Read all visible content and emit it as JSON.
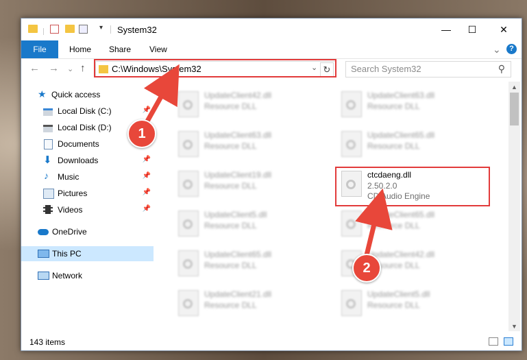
{
  "window": {
    "title": "System32"
  },
  "titlebar": {
    "minimize_glyph": "—",
    "maximize_glyph": "☐",
    "close_glyph": "✕"
  },
  "ribbon": {
    "tabs": [
      {
        "label": "File"
      },
      {
        "label": "Home"
      },
      {
        "label": "Share"
      },
      {
        "label": "View"
      }
    ],
    "expand_glyph": "⌄",
    "help_glyph": "?"
  },
  "nav": {
    "back_glyph": "←",
    "forward_glyph": "→",
    "recent_glyph": "⌄",
    "up_glyph": "↑",
    "address": "C:\\Windows\\System32",
    "address_dropdown_glyph": "⌄",
    "refresh_glyph": "↻",
    "search_placeholder": "Search System32",
    "search_glyph": "⚲"
  },
  "sidebar": {
    "items": [
      {
        "label": "Quick access"
      },
      {
        "label": "Local Disk (C:)"
      },
      {
        "label": "Local Disk (D:)"
      },
      {
        "label": "Documents"
      },
      {
        "label": "Downloads"
      },
      {
        "label": "Music"
      },
      {
        "label": "Pictures"
      },
      {
        "label": "Videos"
      },
      {
        "label": "OneDrive"
      },
      {
        "label": "This PC"
      },
      {
        "label": "Network"
      }
    ],
    "pin_glyph": "📌"
  },
  "files": {
    "left": [
      {
        "name": "UpdateClient42.dll",
        "type": "Resource DLL"
      },
      {
        "name": "UpdateClient63.dll",
        "type": "Resource DLL"
      },
      {
        "name": "UpdateClient19.dll",
        "type": "Resource DLL"
      },
      {
        "name": "UpdateClient5.dll",
        "type": "Resource DLL"
      },
      {
        "name": "UpdateClient65.dll",
        "type": "Resource DLL"
      },
      {
        "name": "UpdateClient21.dll",
        "type": "Resource DLL"
      }
    ],
    "right": [
      {
        "name": "UpdateClient63.dll",
        "type": "Resource DLL"
      },
      {
        "name": "UpdateClient65.dll",
        "type": "Resource DLL"
      },
      {
        "name": "ctcdaeng.dll",
        "version": "2.50.2.0",
        "description": "CD Audio Engine"
      },
      {
        "name": "UpdateClient65.dll",
        "type": "Resource DLL"
      },
      {
        "name": "UpdateClient42.dll",
        "type": "Resource DLL"
      },
      {
        "name": "UpdateClient5.dll",
        "type": "Resource DLL"
      }
    ]
  },
  "status": {
    "item_count": "143 items"
  },
  "markers": {
    "one": "1",
    "two": "2"
  },
  "colors": {
    "accent": "#1979ca",
    "highlight": "#e23a3a",
    "selection": "#cce8ff"
  }
}
